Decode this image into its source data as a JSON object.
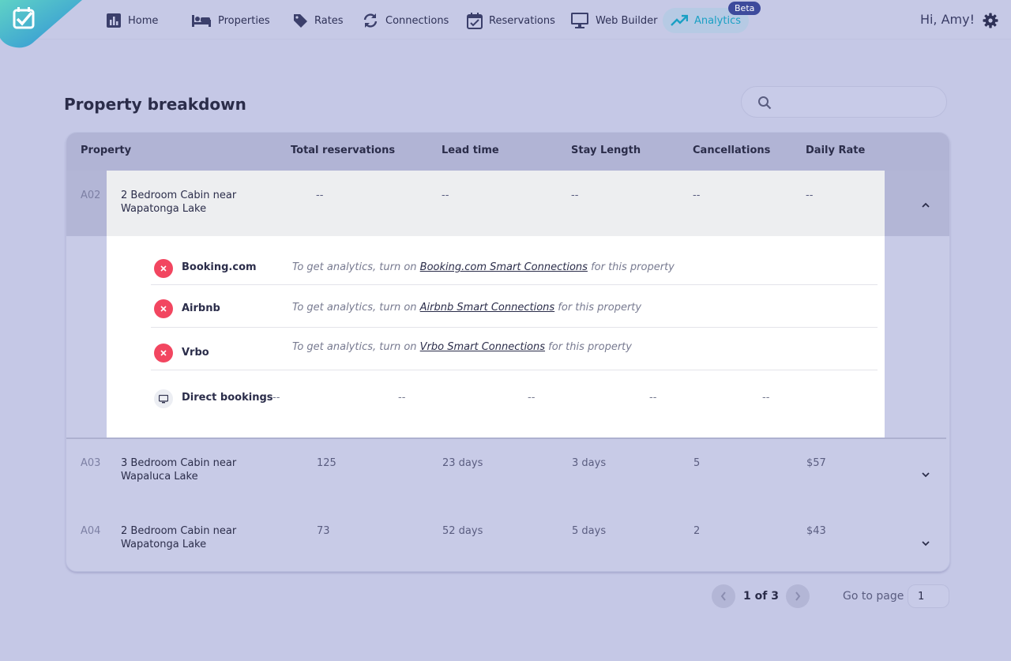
{
  "nav": {
    "items": [
      {
        "label": "Home",
        "icon": "bar-chart-icon"
      },
      {
        "label": "Properties",
        "icon": "bed-icon"
      },
      {
        "label": "Rates",
        "icon": "tag-icon"
      },
      {
        "label": "Connections",
        "icon": "sync-icon"
      },
      {
        "label": "Reservations",
        "icon": "calendar-check-icon"
      },
      {
        "label": "Web Builder",
        "icon": "monitor-icon"
      },
      {
        "label": "Analytics",
        "icon": "trending-up-icon"
      }
    ],
    "beta": "Beta",
    "greeting": "Hi, Amy!"
  },
  "page": {
    "title": "Property breakdown",
    "search_placeholder": ""
  },
  "table": {
    "headers": [
      "Property",
      "Total reservations",
      "Lead time",
      "Stay Length",
      "Cancellations",
      "Daily Rate"
    ],
    "expanded": {
      "id": "A02",
      "name": "2 Bedroom Cabin near Wapatonga Lake",
      "values": [
        "--",
        "--",
        "--",
        "--",
        "--"
      ],
      "channels": [
        {
          "name": "Booking.com",
          "pre": "To get analytics, turn on ",
          "link": "Booking.com Smart Connections",
          "post": " for this property"
        },
        {
          "name": "Airbnb",
          "pre": "To get analytics, turn on ",
          "link": "Airbnb Smart Connections",
          "post": " for this property"
        },
        {
          "name": "Vrbo",
          "pre": "To get analytics, turn on ",
          "link": "Vrbo Smart Connections",
          "post": " for this property"
        }
      ],
      "direct": {
        "name": "Direct bookings",
        "values": [
          "--",
          "--",
          "--",
          "--",
          "--"
        ]
      }
    },
    "rows": [
      {
        "id": "A03",
        "name": "3 Bedroom Cabin near Wapaluca Lake",
        "values": [
          "125",
          "23 days",
          "3 days",
          "5",
          "$57"
        ]
      },
      {
        "id": "A04",
        "name": "2 Bedroom Cabin near Wapatonga Lake",
        "values": [
          "73",
          "52 days",
          "5 days",
          "2",
          "$43"
        ]
      }
    ]
  },
  "pager": {
    "count": "1 of 3",
    "goto_label": "Go to page",
    "goto_value": "1"
  },
  "colors": {
    "background": "#c5c8e6",
    "accent": "#1aa0c4",
    "error": "#f24660",
    "beta": "#3d4a9c"
  }
}
